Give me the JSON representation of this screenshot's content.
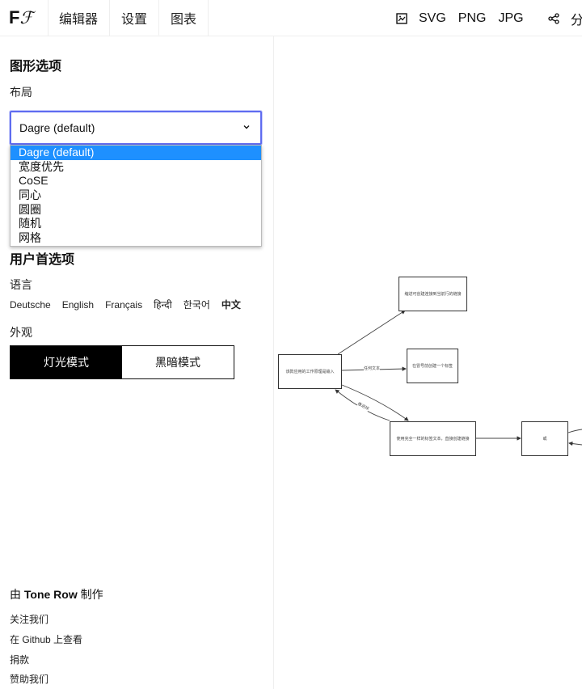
{
  "header": {
    "logo": {
      "bold": "F",
      "script": "ℱ"
    },
    "tabs": [
      {
        "label": "编辑器",
        "active": false
      },
      {
        "label": "设置",
        "active": true
      },
      {
        "label": "图表",
        "active": false
      }
    ],
    "export_icon": "image-icon",
    "exports": [
      "SVG",
      "PNG",
      "JPG"
    ],
    "share_icon": "share-icon",
    "share_label": "分"
  },
  "sidebar": {
    "graph_options_title": "图形选项",
    "layout_label": "布局",
    "layout_select": {
      "value": "Dagre (default)",
      "options": [
        "Dagre (default)",
        "宽度优先",
        "CoSE",
        "同心",
        "圆圈",
        "随机",
        "网格"
      ],
      "highlighted": "Dagre (default)"
    },
    "user_prefs_title": "用户首选项",
    "language_label": "语言",
    "languages": [
      {
        "label": "Deutsche",
        "current": false
      },
      {
        "label": "English",
        "current": false
      },
      {
        "label": "Français",
        "current": false
      },
      {
        "label": "हिन्दी",
        "current": false
      },
      {
        "label": "한국어",
        "current": false
      },
      {
        "label": "中文",
        "current": true
      }
    ],
    "appearance_label": "外观",
    "modes": [
      {
        "label": "灯光模式",
        "active": true
      },
      {
        "label": "黑暗模式",
        "active": false
      }
    ],
    "made_by": {
      "prefix": "由",
      "name": "Tone Row",
      "suffix": "制作"
    },
    "links": [
      "关注我们",
      "在 Github 上查看",
      "捐款",
      "赞助我们"
    ]
  },
  "graph": {
    "nodes": [
      {
        "id": "n1",
        "label": "该款应用的工作原理是输入"
      },
      {
        "id": "n2",
        "label": "缩进可创建连接到当前行的链接"
      },
      {
        "id": "n3",
        "label": "在冒号前创建一个标签"
      },
      {
        "id": "n4",
        "label": "使用完全一样的标签文本，直接创建链接"
      },
      {
        "id": "n5",
        "label": "或"
      }
    ],
    "edges": [
      {
        "from": "n1",
        "to": "n2",
        "label": ""
      },
      {
        "from": "n1",
        "to": "n3",
        "label": "任何文本"
      },
      {
        "from": "n1",
        "to": "n4",
        "label": ""
      },
      {
        "from": "n4",
        "to": "n1",
        "label": "像这样"
      },
      {
        "from": "n4",
        "to": "n5",
        "label": ""
      }
    ]
  }
}
